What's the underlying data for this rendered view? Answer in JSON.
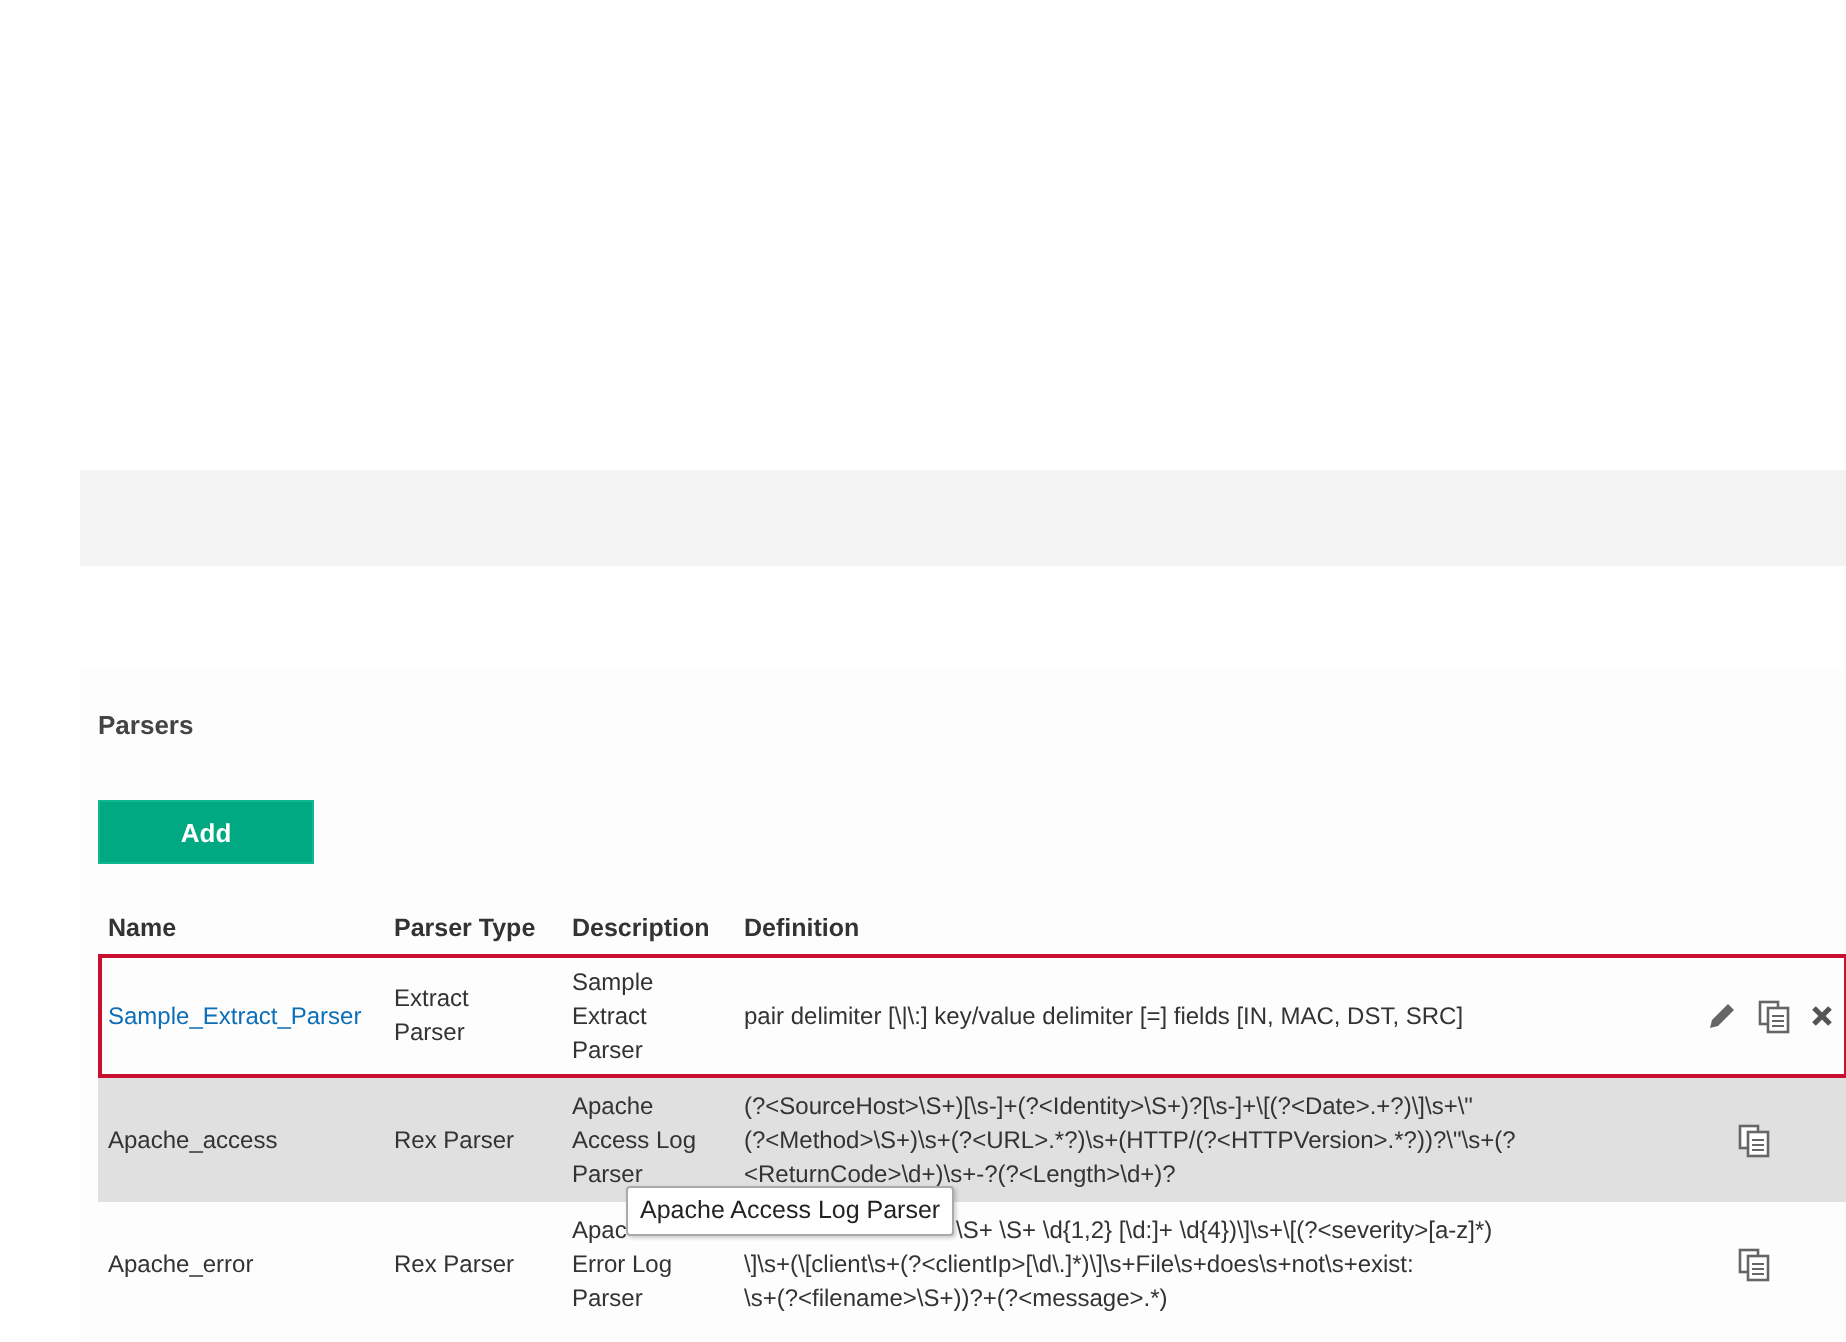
{
  "section_title": "Parsers",
  "add_button": "Add",
  "table": {
    "columns": [
      "Name",
      "Parser Type",
      "Description",
      "Definition"
    ],
    "rows": [
      {
        "name": "Sample_Extract_Parser",
        "selected": true,
        "type_lines": [
          "Extract",
          "Parser"
        ],
        "description_lines": [
          "Sample",
          "Extract",
          "Parser"
        ],
        "definition_lines": [
          "pair delimiter [\\|\\:] key/value delimiter [=] fields [IN, MAC, DST, SRC]"
        ]
      },
      {
        "name": "Apache_access",
        "selected": false,
        "type_lines": [
          "Rex Parser"
        ],
        "description_lines": [
          "Apache",
          "Access Log",
          "Parser"
        ],
        "definition_lines": [
          "(?<SourceHost>\\S+)[\\s-]+(?<Identity>\\S+)?[\\s-]+\\[(?<Date>.+?)\\]\\s+\\\"",
          "(?<Method>\\S+)\\s+(?<URL>.*?)\\s+(HTTP/(?<HTTPVersion>.*?))?\\\"\\s+(?",
          "<ReturnCode>\\d+)\\s+-?(?<Length>\\d+)?"
        ]
      },
      {
        "name": "Apache_error",
        "selected": false,
        "type_lines": [
          "Rex Parser"
        ],
        "description_lines": [
          "Apac",
          "Error Log",
          "Parser"
        ],
        "definition_lines": [
          "\\S+ \\S+ \\d{1,2} [\\d:]+ \\d{4})\\]\\s+\\[(?<severity>[a-z]*)",
          "\\]\\s+(\\[client\\s+(?<clientIp>[\\d\\.]*)\\]\\s+File\\s+does\\s+not\\s+exist:",
          "\\s+(?<filename>\\S+))?+(?<message>.*)"
        ]
      }
    ]
  },
  "tooltip": "Apache Access Log Parser"
}
